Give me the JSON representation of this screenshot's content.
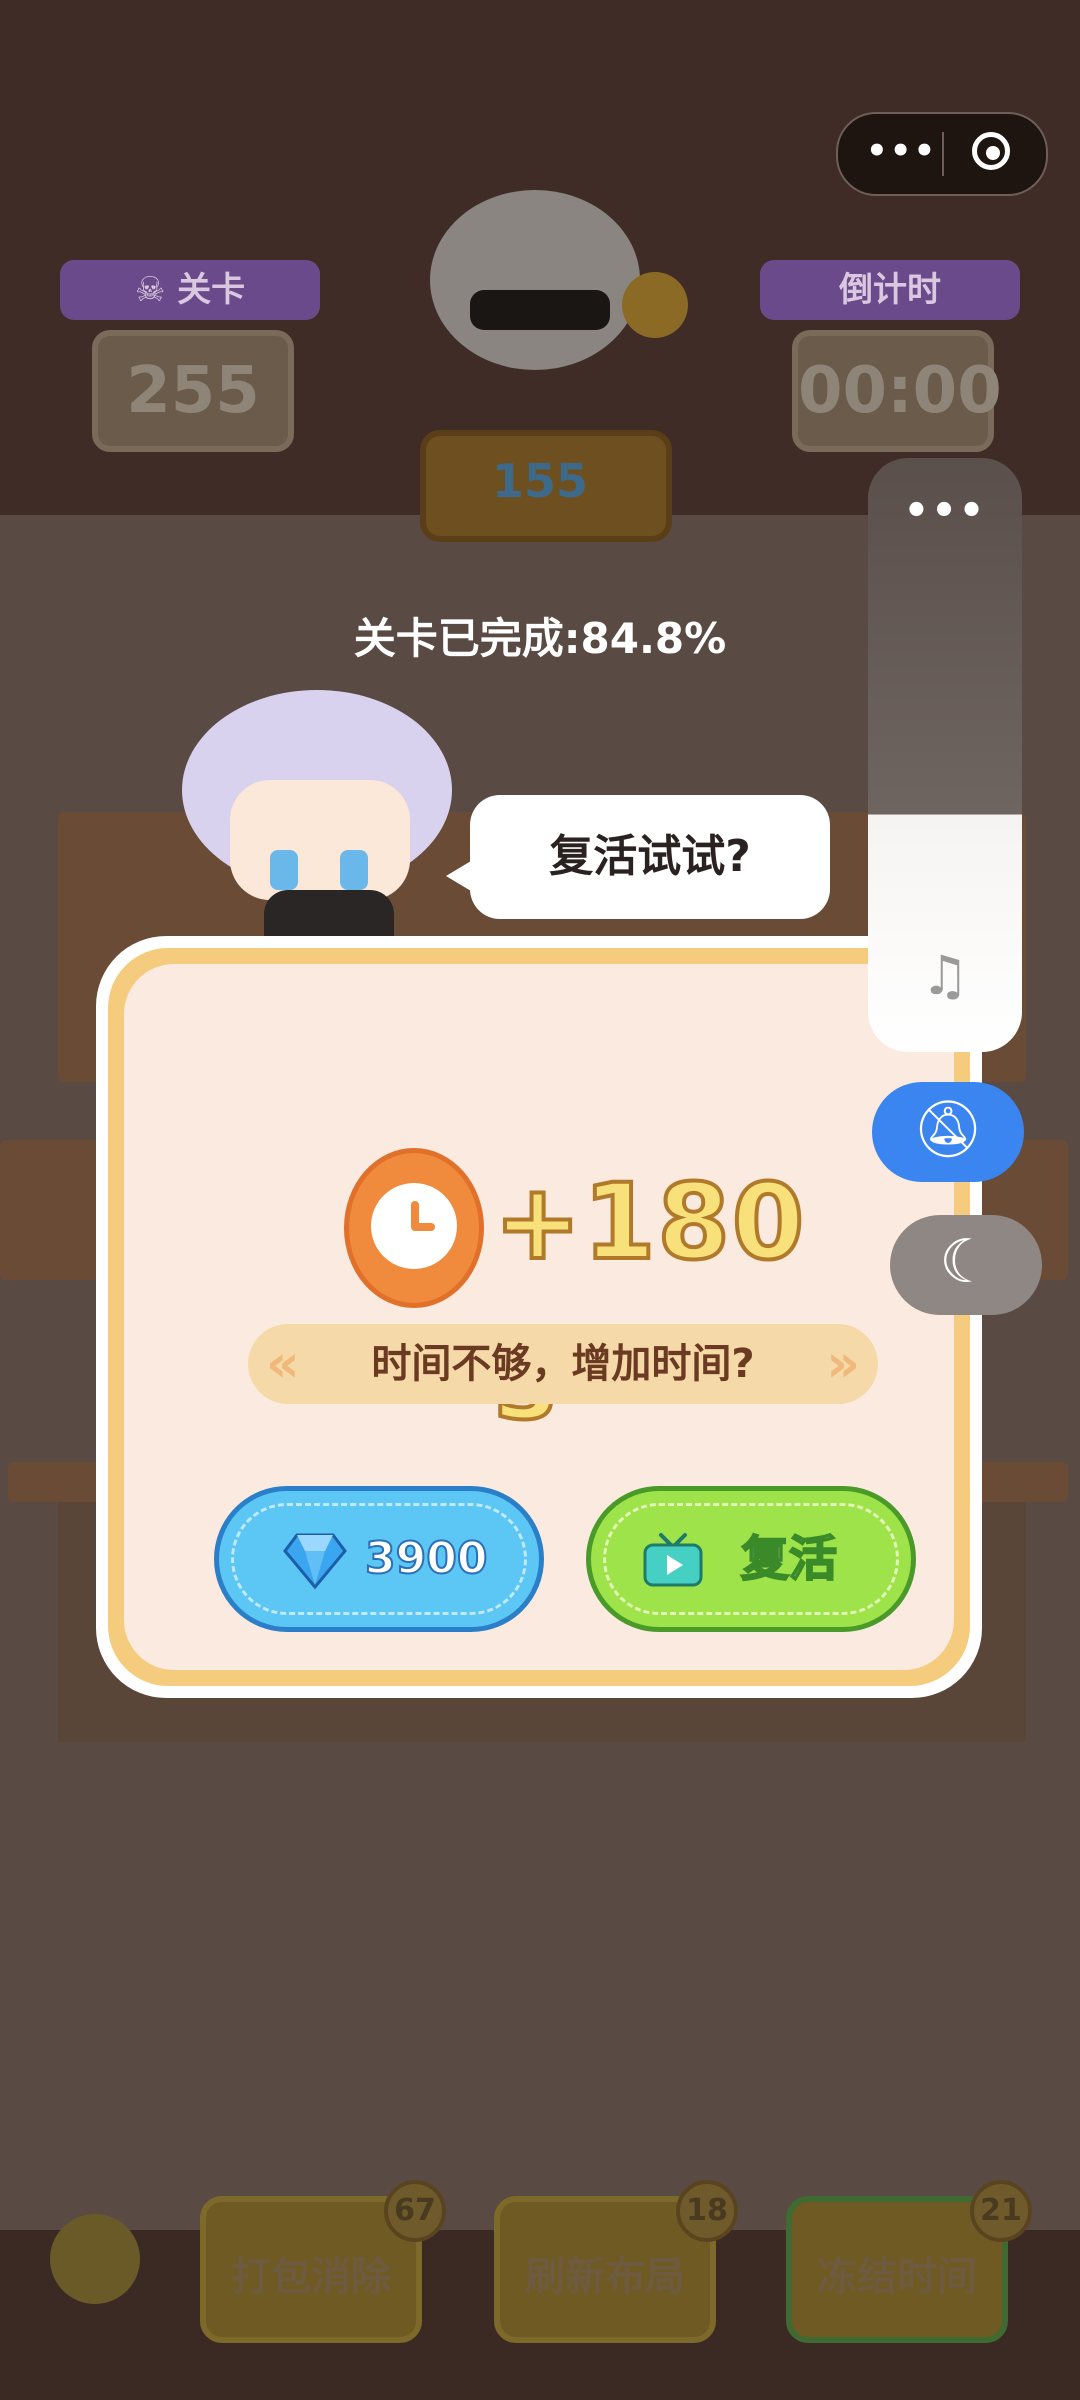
{
  "header": {
    "level_label": "关卡",
    "level_value": "255",
    "timer_label": "倒计时",
    "timer_value": "00:00",
    "gems_value": "155"
  },
  "capsule": {
    "more_label": "•••"
  },
  "progress": {
    "text": "关卡已完成:84.8%"
  },
  "speech": {
    "text": "复活试试?"
  },
  "popup": {
    "bonus_text": "+180 s",
    "hint": "时间不够，增加时间?",
    "gem_button_label": "3900",
    "revive_button_label": "复活"
  },
  "boosters": [
    {
      "label": "打包消除",
      "count": "67"
    },
    {
      "label": "刷新布局",
      "count": "18"
    },
    {
      "label": "冻结时间",
      "count": "21"
    }
  ],
  "side_panel": {
    "dots": "•••"
  },
  "colors": {
    "accent_blue": "#3a85f0",
    "gem_button": "#5cc6f5",
    "revive_button": "#9ee34a",
    "bonus_text": "#f8e07a"
  }
}
